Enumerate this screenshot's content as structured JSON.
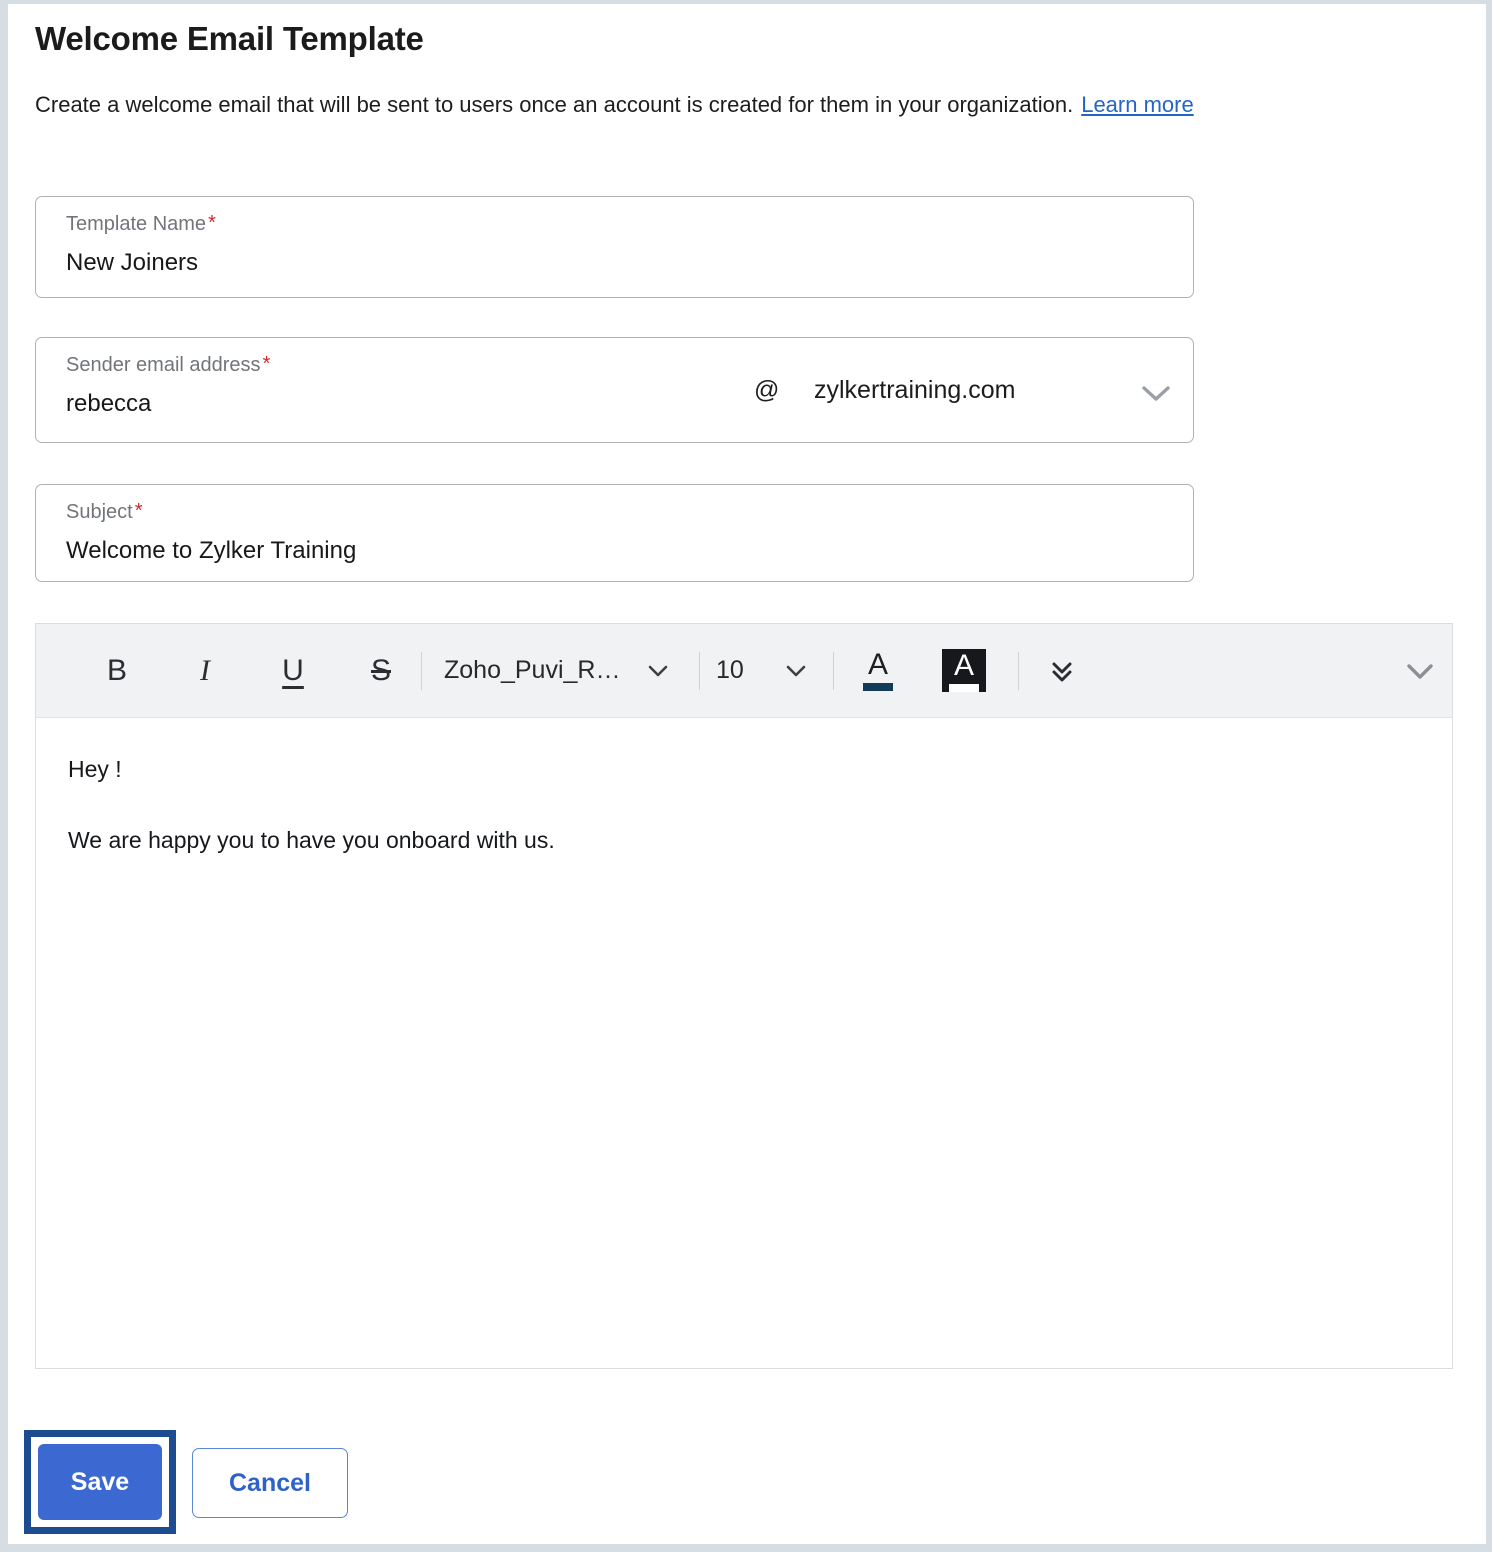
{
  "header": {
    "title": "Welcome Email Template",
    "description": "Create a welcome email that will be sent to users once an account is created for them in your organization.",
    "learn_more": "Learn more"
  },
  "form": {
    "template_name": {
      "label": "Template Name",
      "required_marker": "*",
      "value": "New Joiners",
      "placeholder": "Template Name"
    },
    "sender_email": {
      "label": "Sender email address",
      "required_marker": "*",
      "value": "rebecca",
      "placeholder": "Sender email address",
      "at_symbol": "@",
      "domain": "zylkertraining.com",
      "domain_caret_icon": "chevron-down-icon"
    },
    "subject": {
      "label": "Subject",
      "required_marker": "*",
      "value": "Welcome to Zylker Training",
      "placeholder": "Subject"
    }
  },
  "editor": {
    "toolbar": {
      "bold": "B",
      "italic": "I",
      "underline": "U",
      "strikethrough": "S",
      "font_family": "Zoho_Puvi_R…",
      "font_family_caret_icon": "chevron-down-icon",
      "font_size": "10",
      "font_size_caret_icon": "chevron-down-icon",
      "font_color_letter": "A",
      "font_color_icon": "font-color-icon",
      "font_color_swatch": "#123a59",
      "highlight_letter": "A",
      "highlight_icon": "text-highlight-icon",
      "highlight_swatch": "#ffffff",
      "more_options_icon": "double-chevron-down-icon",
      "expand_toolbar_icon": "chevron-down-icon"
    },
    "body": {
      "line1": "Hey !",
      "line2": "We are happy you to have you onboard with us."
    }
  },
  "actions": {
    "save_label": "Save",
    "cancel_label": "Cancel"
  },
  "colors": {
    "primary_blue": "#3b68d1",
    "focus_ring": "#1d4b8f",
    "link_blue": "#2566c4",
    "required_red": "#d8232a",
    "toolbar_bg": "#f1f2f4",
    "page_bg": "#d6dde3"
  }
}
